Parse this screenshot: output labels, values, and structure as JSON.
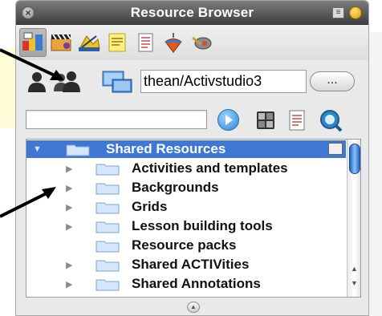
{
  "window": {
    "title": "Resource Browser",
    "close_glyph": "×",
    "menu_glyph": "≡"
  },
  "toolbar": {
    "buttons": [
      {
        "icon": "resource-library-icon",
        "active": true
      },
      {
        "icon": "my-resources-icon",
        "active": false
      },
      {
        "icon": "shared-resources-icon",
        "active": false
      },
      {
        "icon": "page-notes-icon",
        "active": false
      },
      {
        "icon": "document-icon",
        "active": false
      },
      {
        "icon": "spinning-top-icon",
        "active": false
      },
      {
        "icon": "tools-icon",
        "active": false
      }
    ]
  },
  "path": {
    "value": "thean/Activstudio3",
    "browse_label": "...",
    "icons": [
      "single-user-icon",
      "users-group-icon",
      "computer-icon"
    ]
  },
  "search": {
    "value": "",
    "placeholder": "",
    "icons": [
      "search-go-icon",
      "view-toggle-icon",
      "page-properties-icon",
      "refresh-search-icon"
    ]
  },
  "tree": {
    "root": {
      "label": "Shared Resources",
      "expanded": true
    },
    "items": [
      {
        "label": "Activities and templates",
        "has_children": true
      },
      {
        "label": "Backgrounds",
        "has_children": true
      },
      {
        "label": "Grids",
        "has_children": true
      },
      {
        "label": "Lesson building tools",
        "has_children": true
      },
      {
        "label": "Resource packs",
        "has_children": false
      },
      {
        "label": "Shared ACTIVities",
        "has_children": true
      },
      {
        "label": "Shared Annotations",
        "has_children": true
      }
    ]
  },
  "colors": {
    "selection": "#3f78d4",
    "scroll_thumb": "#1f64c8",
    "annotation_arrow": "#000000"
  },
  "footer": {
    "toggle_glyph": "▲"
  }
}
